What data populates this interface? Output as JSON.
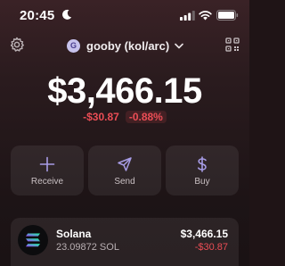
{
  "status_bar": {
    "time": "20:45",
    "icons": [
      "moon-icon",
      "signal-icon",
      "wifi-icon",
      "battery-icon"
    ]
  },
  "header": {
    "avatar_letter": "G",
    "account_name": "gooby (kol/arc)",
    "left_icon": "gear-icon",
    "right_icon": "qr-code-icon"
  },
  "balance": {
    "total": "$3,466.15",
    "change_amount": "-$30.87",
    "change_percent": "-0.88%"
  },
  "actions": [
    {
      "label": "Receive",
      "icon": "plus-icon"
    },
    {
      "label": "Send",
      "icon": "send-icon"
    },
    {
      "label": "Buy",
      "icon": "dollar-icon"
    }
  ],
  "tokens": [
    {
      "name": "Solana",
      "amount": "23.09872 SOL",
      "value": "$3,466.15",
      "change": "-$30.87",
      "icon": "solana-icon"
    }
  ],
  "colors": {
    "background": "#2a1b1e",
    "negative": "#eb4d55",
    "avatar_bg": "#c7c2ec",
    "card": "#382a2d"
  }
}
